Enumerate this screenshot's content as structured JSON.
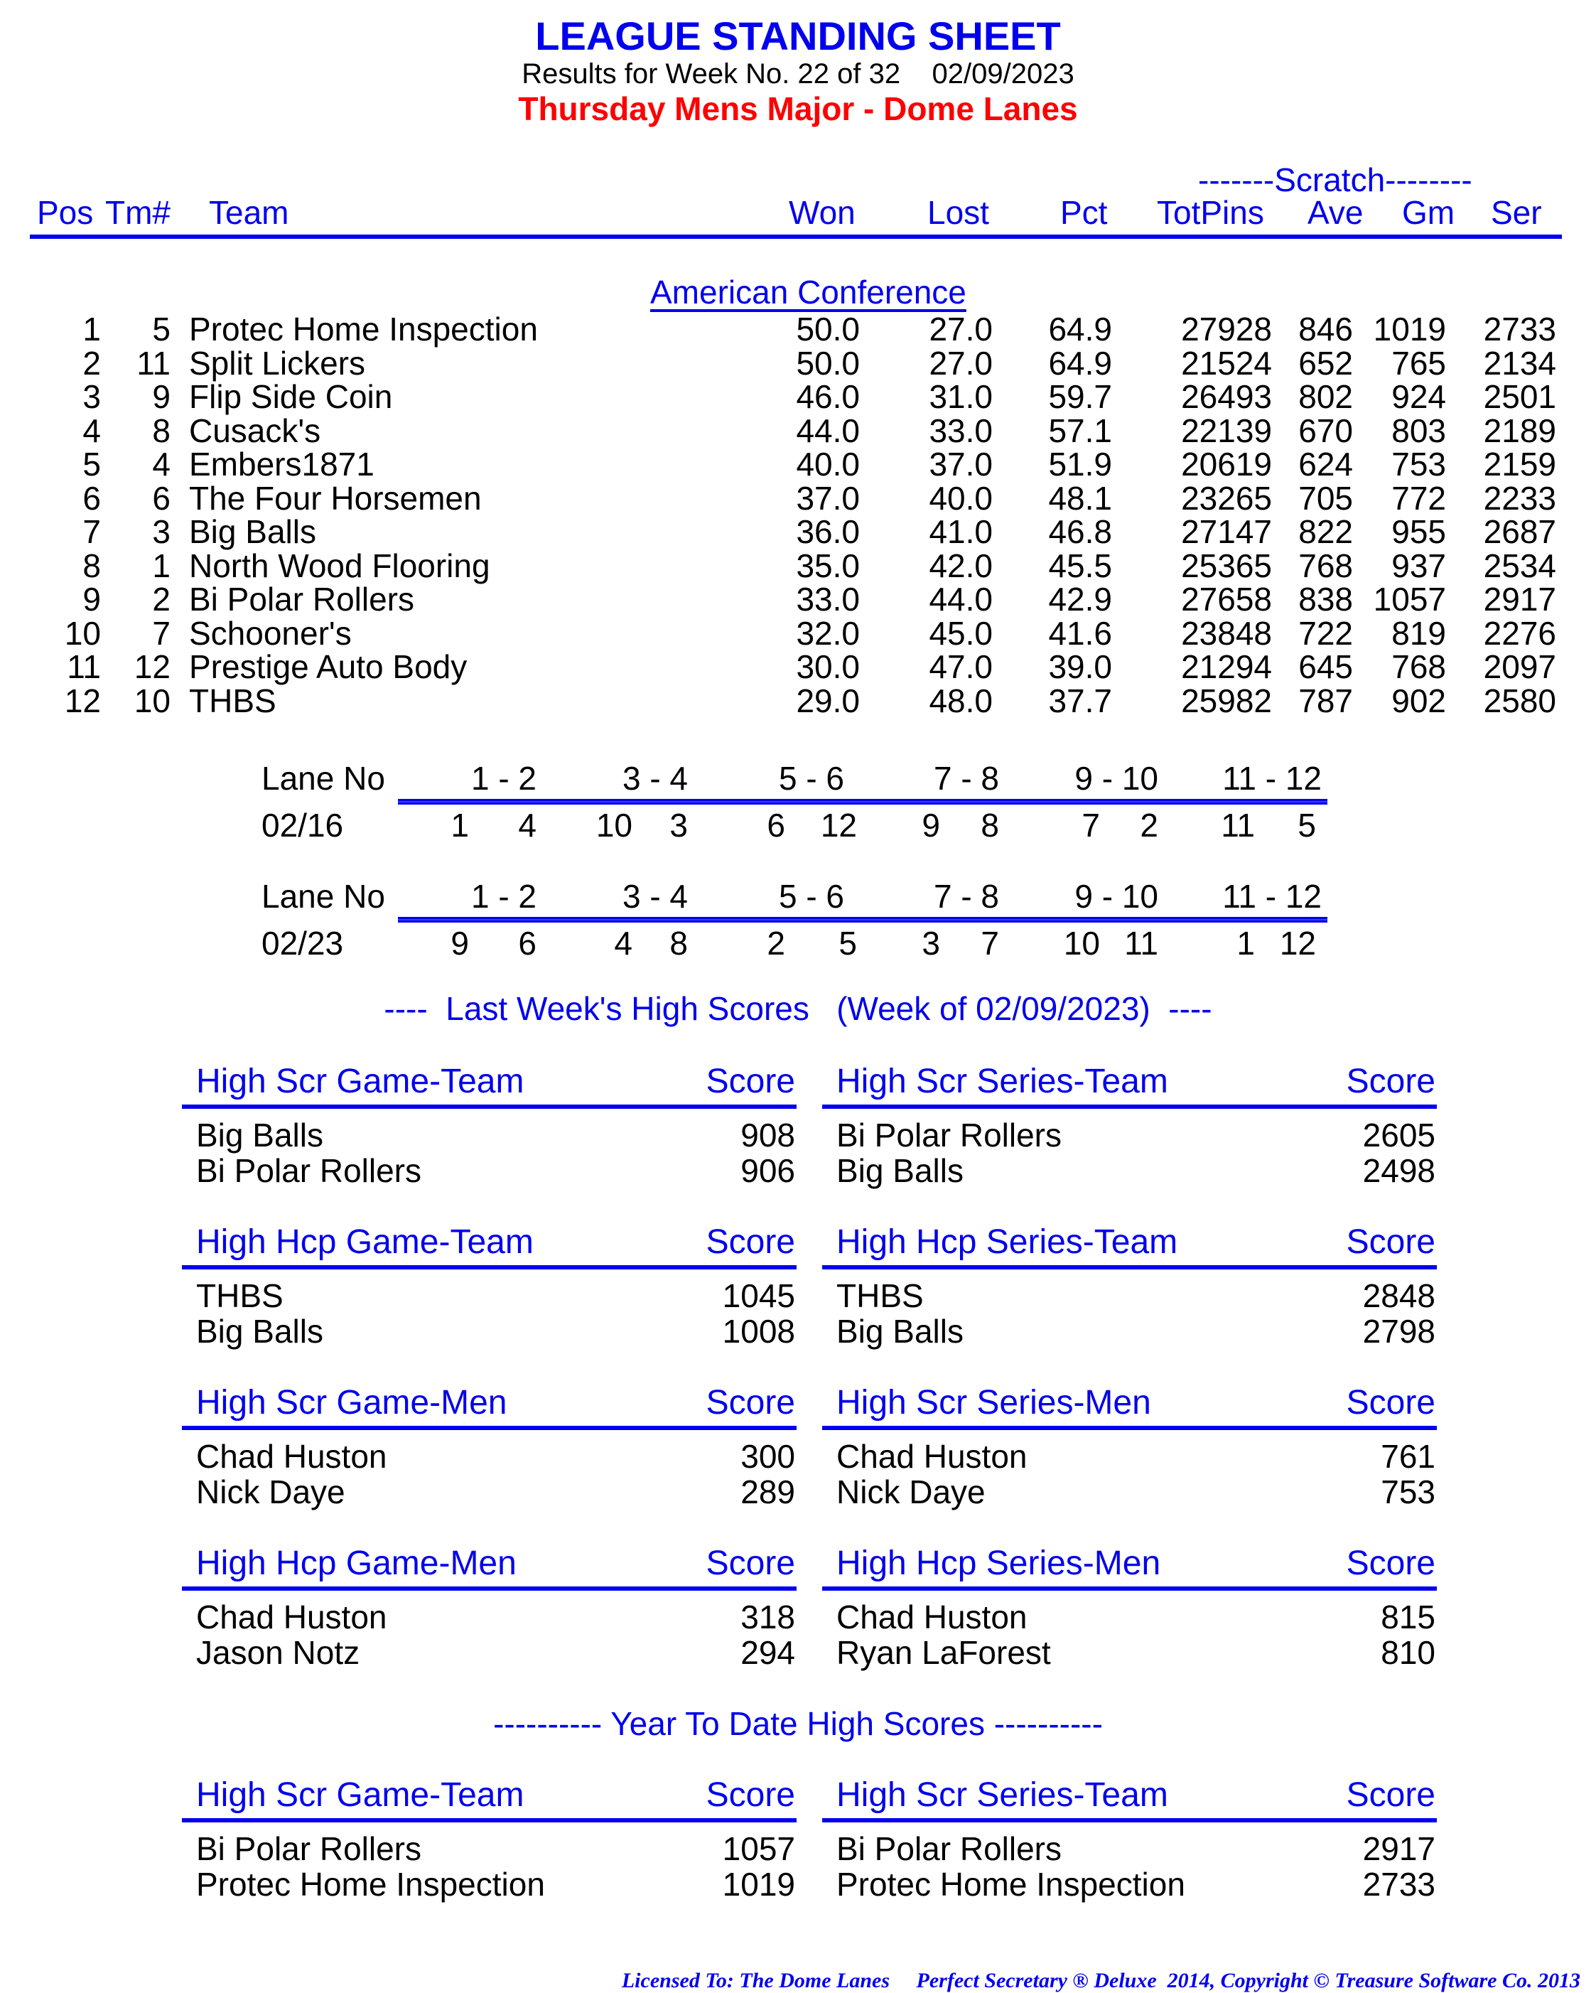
{
  "header": {
    "title": "LEAGUE STANDING SHEET",
    "subtitle": "Results for Week No. 22 of 32    02/09/2023",
    "league": "Thursday Mens Major - Dome Lanes"
  },
  "standings": {
    "scratch_label": "-------Scratch--------",
    "columns": [
      "Pos",
      "Tm#",
      "Team",
      "Won",
      "Lost",
      "Pct",
      "TotPins",
      "Ave",
      "Gm",
      "Ser"
    ],
    "conference": "American Conference",
    "rows": [
      {
        "pos": "1",
        "tm": "5",
        "team": "Protec Home Inspection",
        "won": "50.0",
        "lost": "27.0",
        "pct": "64.9",
        "totpins": "27928",
        "ave": "846",
        "gm": "1019",
        "ser": "2733"
      },
      {
        "pos": "2",
        "tm": "11",
        "team": "Split Lickers",
        "won": "50.0",
        "lost": "27.0",
        "pct": "64.9",
        "totpins": "21524",
        "ave": "652",
        "gm": "765",
        "ser": "2134"
      },
      {
        "pos": "3",
        "tm": "9",
        "team": "Flip Side Coin",
        "won": "46.0",
        "lost": "31.0",
        "pct": "59.7",
        "totpins": "26493",
        "ave": "802",
        "gm": "924",
        "ser": "2501"
      },
      {
        "pos": "4",
        "tm": "8",
        "team": "Cusack's",
        "won": "44.0",
        "lost": "33.0",
        "pct": "57.1",
        "totpins": "22139",
        "ave": "670",
        "gm": "803",
        "ser": "2189"
      },
      {
        "pos": "5",
        "tm": "4",
        "team": "Embers1871",
        "won": "40.0",
        "lost": "37.0",
        "pct": "51.9",
        "totpins": "20619",
        "ave": "624",
        "gm": "753",
        "ser": "2159"
      },
      {
        "pos": "6",
        "tm": "6",
        "team": "The Four Horsemen",
        "won": "37.0",
        "lost": "40.0",
        "pct": "48.1",
        "totpins": "23265",
        "ave": "705",
        "gm": "772",
        "ser": "2233"
      },
      {
        "pos": "7",
        "tm": "3",
        "team": "Big Balls",
        "won": "36.0",
        "lost": "41.0",
        "pct": "46.8",
        "totpins": "27147",
        "ave": "822",
        "gm": "955",
        "ser": "2687"
      },
      {
        "pos": "8",
        "tm": "1",
        "team": "North Wood Flooring",
        "won": "35.0",
        "lost": "42.0",
        "pct": "45.5",
        "totpins": "25365",
        "ave": "768",
        "gm": "937",
        "ser": "2534"
      },
      {
        "pos": "9",
        "tm": "2",
        "team": "Bi Polar Rollers",
        "won": "33.0",
        "lost": "44.0",
        "pct": "42.9",
        "totpins": "27658",
        "ave": "838",
        "gm": "1057",
        "ser": "2917"
      },
      {
        "pos": "10",
        "tm": "7",
        "team": "Schooner's",
        "won": "32.0",
        "lost": "45.0",
        "pct": "41.6",
        "totpins": "23848",
        "ave": "722",
        "gm": "819",
        "ser": "2276"
      },
      {
        "pos": "11",
        "tm": "12",
        "team": "Prestige Auto Body",
        "won": "30.0",
        "lost": "47.0",
        "pct": "39.0",
        "totpins": "21294",
        "ave": "645",
        "gm": "768",
        "ser": "2097"
      },
      {
        "pos": "12",
        "tm": "10",
        "team": "THBS",
        "won": "29.0",
        "lost": "48.0",
        "pct": "37.7",
        "totpins": "25982",
        "ave": "787",
        "gm": "902",
        "ser": "2580"
      }
    ]
  },
  "lanes": {
    "label": "Lane No",
    "pairs": [
      "1 - 2",
      "3 - 4",
      "5 - 6",
      "7 - 8",
      "9 - 10",
      "11 - 12"
    ],
    "schedule": [
      {
        "date": "02/16",
        "teams": [
          [
            "1",
            "4"
          ],
          [
            "10",
            "3"
          ],
          [
            "6",
            "12"
          ],
          [
            "9",
            "8"
          ],
          [
            "7",
            "2"
          ],
          [
            "11",
            "5"
          ]
        ]
      },
      {
        "date": "02/23",
        "teams": [
          [
            "9",
            "6"
          ],
          [
            "4",
            "8"
          ],
          [
            "2",
            "5"
          ],
          [
            "3",
            "7"
          ],
          [
            "10",
            "11"
          ],
          [
            "1",
            "12"
          ]
        ]
      }
    ]
  },
  "last_week": {
    "title": "----  Last Week's High Scores   (Week of 02/09/2023)  ----",
    "boxes": [
      {
        "label": "High Scr Game-Team",
        "score_label": "Score",
        "entries": [
          {
            "name": "Big Balls",
            "score": "908"
          },
          {
            "name": "Bi Polar Rollers",
            "score": "906"
          }
        ]
      },
      {
        "label": "High Scr Series-Team",
        "score_label": "Score",
        "entries": [
          {
            "name": "Bi Polar Rollers",
            "score": "2605"
          },
          {
            "name": "Big Balls",
            "score": "2498"
          }
        ]
      },
      {
        "label": "High Hcp Game-Team",
        "score_label": "Score",
        "entries": [
          {
            "name": "THBS",
            "score": "1045"
          },
          {
            "name": "Big Balls",
            "score": "1008"
          }
        ]
      },
      {
        "label": "High Hcp Series-Team",
        "score_label": "Score",
        "entries": [
          {
            "name": "THBS",
            "score": "2848"
          },
          {
            "name": "Big Balls",
            "score": "2798"
          }
        ]
      },
      {
        "label": "High Scr Game-Men",
        "score_label": "Score",
        "entries": [
          {
            "name": "Chad Huston",
            "score": "300"
          },
          {
            "name": "Nick Daye",
            "score": "289"
          }
        ]
      },
      {
        "label": "High Scr Series-Men",
        "score_label": "Score",
        "entries": [
          {
            "name": "Chad Huston",
            "score": "761"
          },
          {
            "name": "Nick Daye",
            "score": "753"
          }
        ]
      },
      {
        "label": "High Hcp Game-Men",
        "score_label": "Score",
        "entries": [
          {
            "name": "Chad Huston",
            "score": "318"
          },
          {
            "name": "Jason Notz",
            "score": "294"
          }
        ]
      },
      {
        "label": "High Hcp Series-Men",
        "score_label": "Score",
        "entries": [
          {
            "name": "Chad Huston",
            "score": "815"
          },
          {
            "name": "Ryan LaForest",
            "score": "810"
          }
        ]
      }
    ]
  },
  "year_to_date": {
    "title": "---------- Year To Date High Scores ----------",
    "boxes": [
      {
        "label": "High Scr Game-Team",
        "score_label": "Score",
        "entries": [
          {
            "name": "Bi Polar Rollers",
            "score": "1057"
          },
          {
            "name": "Protec Home Inspection",
            "score": "1019"
          }
        ]
      },
      {
        "label": "High Scr Series-Team",
        "score_label": "Score",
        "entries": [
          {
            "name": "Bi Polar Rollers",
            "score": "2917"
          },
          {
            "name": "Protec Home Inspection",
            "score": "2733"
          }
        ]
      }
    ]
  },
  "footer": {
    "text": "Licensed To: The Dome Lanes     Perfect Secretary ® Deluxe  2014, Copyright © Treasure Software Co. 2013"
  },
  "colors": {
    "heading_blue": "#0000ee",
    "league_red": "#ff0000",
    "text": "#000000"
  }
}
